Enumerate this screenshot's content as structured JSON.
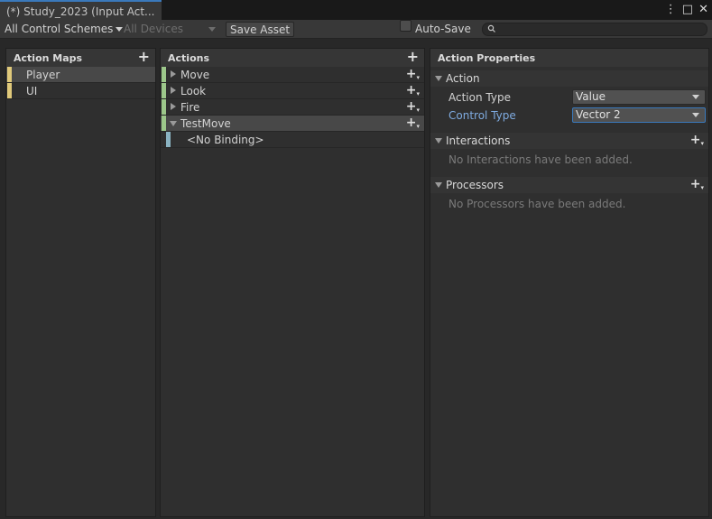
{
  "window": {
    "tab_title": "(*) Study_2023 (Input Act...",
    "menu_glyph": "⋮",
    "maximize_glyph": "□",
    "close_glyph": "✕"
  },
  "toolbar": {
    "control_schemes": "All Control Schemes",
    "devices": "All Devices",
    "save_asset": "Save Asset",
    "auto_save": "Auto-Save",
    "search_value": ""
  },
  "action_maps": {
    "header": "Action Maps",
    "add_glyph": "+",
    "items": [
      {
        "label": "Player"
      },
      {
        "label": "UI"
      }
    ]
  },
  "actions": {
    "header": "Actions",
    "add_glyph": "+",
    "items": [
      {
        "label": "Move"
      },
      {
        "label": "Look"
      },
      {
        "label": "Fire"
      },
      {
        "label": "TestMove"
      }
    ],
    "binding": "<No Binding>"
  },
  "properties": {
    "header": "Action Properties",
    "action_section": "Action",
    "action_type_label": "Action Type",
    "action_type_value": "Value",
    "control_type_label": "Control Type",
    "control_type_value": "Vector 2",
    "interactions_section": "Interactions",
    "interactions_empty": "No Interactions have been added.",
    "processors_section": "Processors",
    "processors_empty": "No Processors have been added."
  },
  "colors": {
    "map_stripe": "#e0c97a",
    "action_stripe": "#9cc78a",
    "binding_stripe": "#8ab3c2",
    "accent": "#3a79bb",
    "active_label": "#7fabe0"
  }
}
